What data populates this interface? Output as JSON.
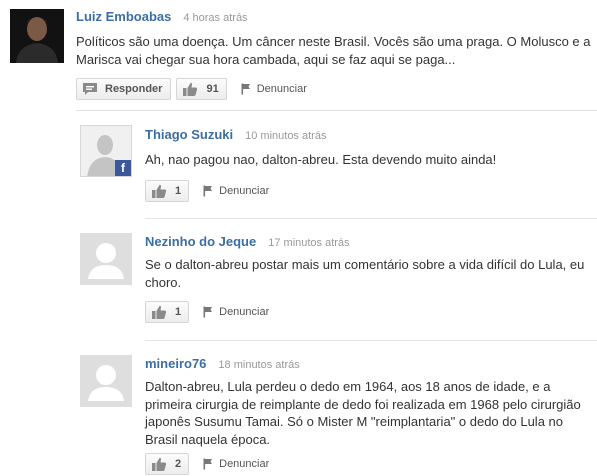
{
  "comments": [
    {
      "author": "Luiz Emboabas",
      "time": "4 horas atrás",
      "text": "Políticos são uma doença. Um câncer neste Brasil. Vocês são uma praga. O Molusco e a Marisca vai chegar sua hora cambada, aqui se faz aqui se paga...",
      "reply_label": "Responder",
      "likes": "91",
      "report_label": "Denunciar"
    },
    {
      "author": "Thiago Suzuki",
      "time": "10 minutos atrás",
      "text": "Ah, nao pagou nao, dalton-abreu. Esta devendo muito ainda!",
      "likes": "1",
      "report_label": "Denunciar"
    },
    {
      "author": "Nezinho do Jeque",
      "time": "17 minutos atrás",
      "text": "Se o dalton-abreu postar mais um comentário sobre a vida difícil do Lula, eu choro.",
      "likes": "1",
      "report_label": "Denunciar"
    },
    {
      "author": "mineiro76",
      "time": "18 minutos atrás",
      "text": "Dalton-abreu, Lula perdeu o dedo em 1964, aos 18 anos de idade, e a primeira cirurgia de reimplante de dedo foi realizada em 1968 pelo cirurgião japonês Susumu Tamai. Só o Mister M \"reimplantaria\" o dedo do Lula no Brasil naquela época.",
      "likes": "2",
      "report_label": "Denunciar"
    }
  ],
  "icons": {
    "reply": "speech-bubble-icon",
    "like": "thumbs-up-icon",
    "report": "flag-icon",
    "facebook": "facebook-icon",
    "default_avatar": "default-user-icon"
  },
  "colors": {
    "author_name": "#3b6ea5",
    "timestamp": "#999999",
    "facebook": "#3b5998"
  }
}
